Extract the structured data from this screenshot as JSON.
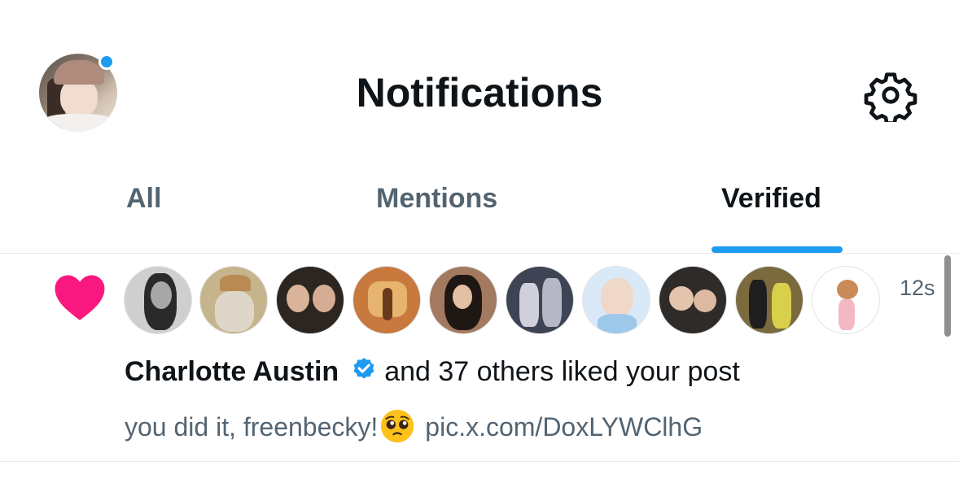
{
  "header": {
    "title": "Notifications",
    "avatar_icon": "profile-avatar",
    "settings_icon": "gear-icon",
    "online_dot_color": "#1d9bf0"
  },
  "tabs": [
    {
      "label": "All",
      "selected": false
    },
    {
      "label": "Mentions",
      "selected": false
    },
    {
      "label": "Verified",
      "selected": true
    }
  ],
  "notification": {
    "icon": "heart-icon",
    "icon_color": "#f91880",
    "timestamp": "12s",
    "liker_count_shown": 10,
    "name": "Charlotte Austin",
    "badge": "verified-badge-icon",
    "rest": "and 37 others liked your post",
    "post_text": "you did it, freenbecky!",
    "post_emoji": "pleading-face-icon",
    "post_link": "pic.x.com/DoxLYWClhG"
  },
  "colors": {
    "accent": "#1d9bf0",
    "text_primary": "#0f1419",
    "text_secondary": "#536471",
    "like": "#f91880"
  }
}
